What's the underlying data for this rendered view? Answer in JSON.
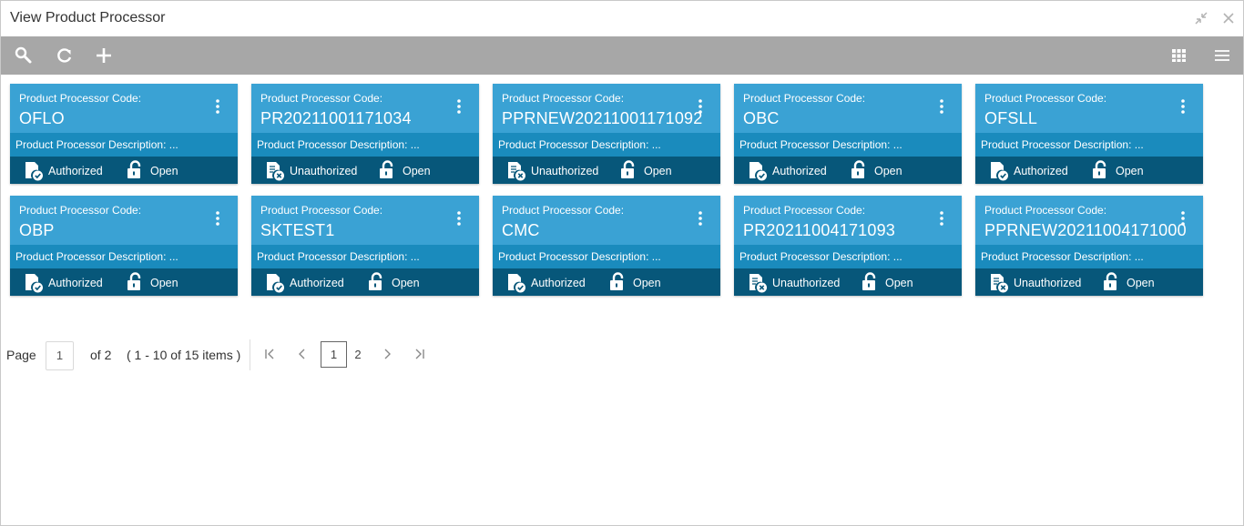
{
  "window": {
    "title": "View Product Processor"
  },
  "toolbar": {
    "icons": [
      "search-icon",
      "refresh-icon",
      "add-icon",
      "grid-view-icon",
      "list-view-icon"
    ]
  },
  "labels": {
    "code_label": "Product Processor Code:",
    "desc_label": "Product Processor Description: ...",
    "open_label": "Open"
  },
  "cards": [
    {
      "code": "OFLO",
      "status": "Authorized"
    },
    {
      "code": "PR20211001171034",
      "status": "Unauthorized"
    },
    {
      "code": "PPRNEW20211001171092",
      "status": "Unauthorized"
    },
    {
      "code": "OBC",
      "status": "Authorized"
    },
    {
      "code": "OFSLL",
      "status": "Authorized"
    },
    {
      "code": "OBP",
      "status": "Authorized"
    },
    {
      "code": "SKTEST1",
      "status": "Authorized"
    },
    {
      "code": "CMC",
      "status": "Authorized"
    },
    {
      "code": "PR20211004171093",
      "status": "Unauthorized"
    },
    {
      "code": "PPRNEW20211004171000",
      "status": "Unauthorized"
    }
  ],
  "pagination": {
    "page_label": "Page",
    "current_page": "1",
    "of_label": "of 2",
    "items_label": "( 1 - 10 of 15 items )",
    "pages": [
      "1",
      "2"
    ]
  },
  "colors": {
    "card_top": "#3aa2d4",
    "card_desc": "#1a8bbd",
    "card_status": "#07577a",
    "toolbar": "#a7a7a7"
  }
}
